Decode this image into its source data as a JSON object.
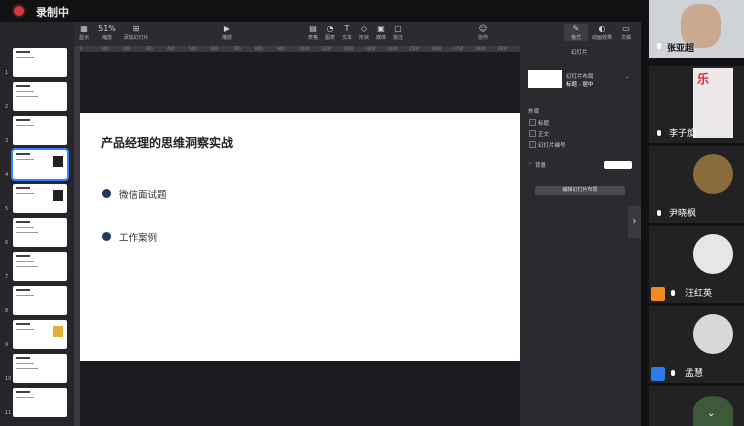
{
  "recording": {
    "label": "录制中"
  },
  "toolbar": {
    "items": [
      {
        "label": "显示",
        "icon": "view-icon"
      },
      {
        "label": "缩放",
        "value": "51%"
      },
      {
        "label": "添加幻灯片",
        "icon": "add-slide-icon"
      },
      {
        "label": "播放",
        "icon": "play-icon"
      },
      {
        "label": "表格",
        "icon": "table-icon"
      },
      {
        "label": "图表",
        "icon": "chart-icon"
      },
      {
        "label": "文本",
        "icon": "text-icon"
      },
      {
        "label": "形状",
        "icon": "shape-icon"
      },
      {
        "label": "媒体",
        "icon": "media-icon"
      },
      {
        "label": "批注",
        "icon": "comment-icon"
      },
      {
        "label": "协作",
        "icon": "collaborate-icon"
      },
      {
        "label": "格式",
        "icon": "format-icon"
      },
      {
        "label": "动画效果",
        "icon": "animation-icon"
      },
      {
        "label": "文稿",
        "icon": "document-icon"
      }
    ]
  },
  "ruler": {
    "ticks": [
      "0",
      "100",
      "200",
      "300",
      "400",
      "500",
      "600",
      "700",
      "800",
      "900",
      "1000",
      "1100",
      "1200",
      "1300",
      "1400",
      "1500",
      "1600",
      "1700",
      "1800",
      "1900"
    ]
  },
  "slides": {
    "numbers": [
      "1",
      "2",
      "3",
      "4",
      "5",
      "6",
      "7",
      "8",
      "9",
      "10",
      "11"
    ],
    "selected": "4"
  },
  "slide": {
    "title": "产品经理的思维洞察实战",
    "bullets": [
      "微信面试题",
      "工作案例"
    ]
  },
  "format_panel": {
    "tab": "幻灯片",
    "layout_title": "幻灯片布局",
    "layout_value": "标题 - 居中",
    "appearance": "外观",
    "options": [
      "标题",
      "正文",
      "幻灯片编号"
    ],
    "background": "背景",
    "edit_layout": "编辑幻灯片布局"
  },
  "participants": [
    {
      "name": "张亚超",
      "avatar": "blue"
    },
    {
      "name": "李子旋",
      "avatar": "none"
    },
    {
      "name": "尹晓枫",
      "avatar": "none"
    },
    {
      "name": "汪红英",
      "avatar": "orange"
    },
    {
      "name": "孟慧",
      "avatar": "blue"
    },
    {
      "name": "",
      "avatar": "none"
    }
  ],
  "colors": {
    "accent": "#2e80ff",
    "bullet": "#1d3a5f",
    "record": "#d23b3b"
  }
}
